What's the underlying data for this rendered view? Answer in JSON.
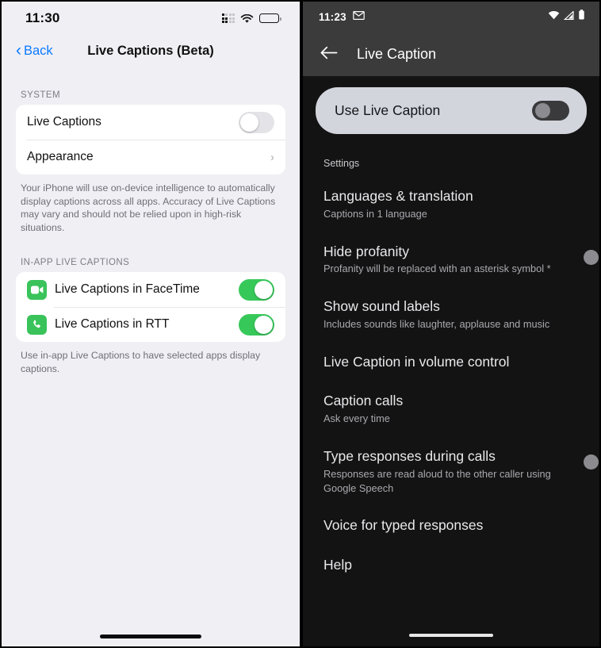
{
  "ios": {
    "status": {
      "time": "11:30",
      "signal_icon": "cellular-signal-icon",
      "wifi_icon": "wifi-icon",
      "battery_icon": "battery-icon"
    },
    "nav": {
      "back_label": "Back",
      "back_icon": "chevron-left-icon",
      "title": "Live Captions (Beta)"
    },
    "sections": [
      {
        "header": "SYSTEM",
        "rows": [
          {
            "label": "Live Captions",
            "control": "switch",
            "state": "off"
          },
          {
            "label": "Appearance",
            "control": "chevron",
            "chevron": "›"
          }
        ],
        "footnote": "Your iPhone will use on-device intelligence to automatically display captions across all apps. Accuracy of Live Captions may vary and should not be relied upon in high-risk situations."
      },
      {
        "header": "IN-APP LIVE CAPTIONS",
        "rows": [
          {
            "label": "Live Captions in FaceTime",
            "control": "switch",
            "state": "on",
            "icon": "facetime-app-icon"
          },
          {
            "label": "Live Captions in RTT",
            "control": "switch",
            "state": "on",
            "icon": "phone-app-icon"
          }
        ],
        "footnote": "Use in-app Live Captions to have selected apps display captions."
      }
    ],
    "home_indicator": "home-indicator"
  },
  "android": {
    "status": {
      "time": "11:23",
      "mail_icon": "envelope-icon",
      "wifi_icon": "wifi-icon",
      "signal_icon": "cellular-signal-icon",
      "battery_icon": "battery-icon"
    },
    "appbar": {
      "back_icon": "arrow-left-icon",
      "title": "Live Caption"
    },
    "master": {
      "label": "Use Live Caption",
      "state": "off"
    },
    "section_header": "Settings",
    "rows": [
      {
        "title": "Languages & translation",
        "subtitle": "Captions in 1 language",
        "control": "none"
      },
      {
        "title": "Hide profanity",
        "subtitle": "Profanity will be replaced with an asterisk symbol *",
        "control": "switch",
        "state": "off"
      },
      {
        "title": "Show sound labels",
        "subtitle": "Includes sounds like laughter, applause and music",
        "control": "switch",
        "state": "on"
      },
      {
        "title": "Live Caption in volume control",
        "subtitle": "",
        "control": "switch",
        "state": "on"
      },
      {
        "title": "Caption calls",
        "subtitle": "Ask every time",
        "control": "none"
      },
      {
        "title": "Type responses during calls",
        "subtitle": "Responses are read aloud to the other caller using Google Speech",
        "control": "switch",
        "state": "off"
      },
      {
        "title": "Voice for typed responses",
        "subtitle": "",
        "control": "none"
      },
      {
        "title": "Help",
        "subtitle": "",
        "control": "none"
      }
    ],
    "home_indicator": "home-indicator"
  },
  "colors": {
    "ios_accent": "#0a7aff",
    "ios_switch_on": "#37c85a",
    "ios_bg": "#f0eff4",
    "android_card": "#d3d5dd",
    "android_bg": "#131313",
    "android_bar": "#3b3b3b"
  }
}
